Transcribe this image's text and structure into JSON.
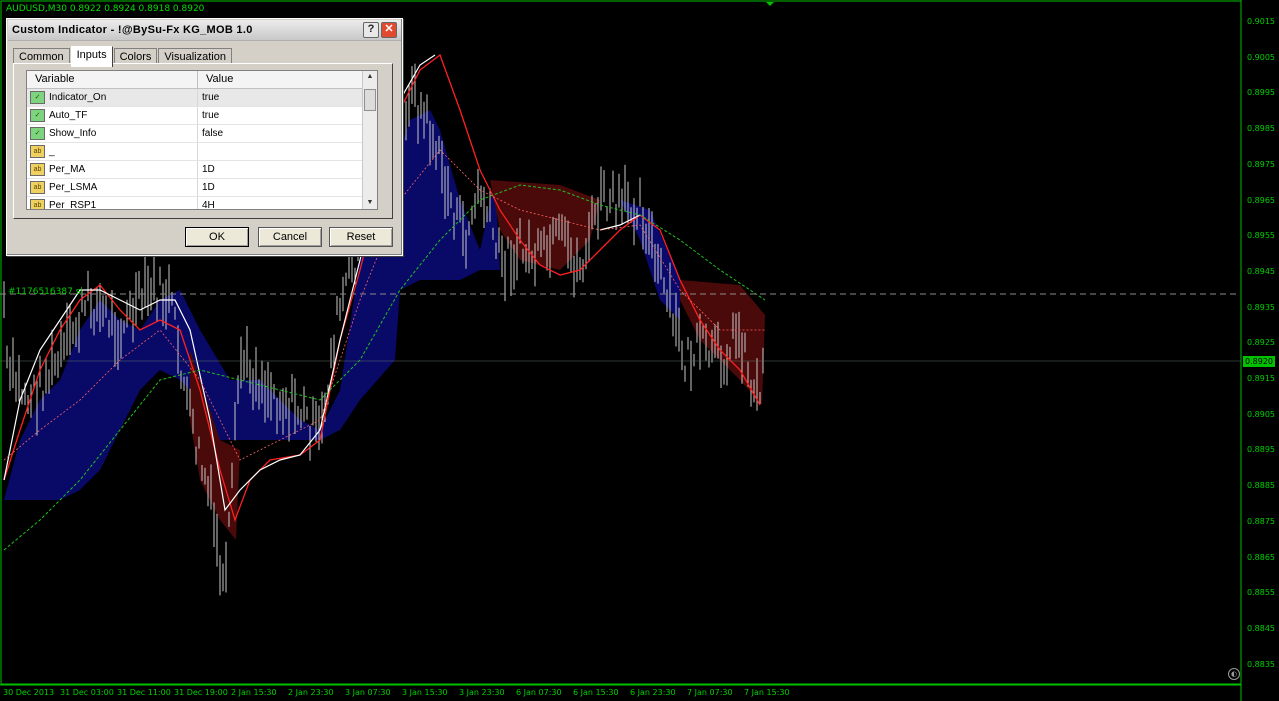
{
  "chart": {
    "symbol_info": "AUDUSD,M30  0.8922 0.8924 0.8918 0.8920",
    "order_label": "#1176516387 sl",
    "current_price": "0.8920",
    "price_ticks": [
      "0.9015",
      "0.9005",
      "0.8995",
      "0.8985",
      "0.8975",
      "0.8965",
      "0.8955",
      "0.8945",
      "0.8935",
      "0.8925",
      "0.8915",
      "0.8905",
      "0.8895",
      "0.8885",
      "0.8875",
      "0.8865",
      "0.8855",
      "0.8845",
      "0.8835"
    ],
    "time_ticks": [
      "30 Dec 2013",
      "31 Dec 03:00",
      "31 Dec 11:00",
      "31 Dec 19:00",
      "2 Jan 15:30",
      "2 Jan 23:30",
      "3 Jan 07:30",
      "3 Jan 15:30",
      "3 Jan 23:30",
      "6 Jan 07:30",
      "6 Jan 15:30",
      "6 Jan 23:30",
      "7 Jan 07:30",
      "7 Jan 15:30"
    ],
    "colors": {
      "background": "#000000",
      "axis": "#00c000",
      "candles": "#c8c8c8",
      "cloud_bull": "#0a0a6e",
      "cloud_bear": "#4a0a0a",
      "ma_red": "#ff2020",
      "ma_white": "#ffffff",
      "ma_green": "#20c020"
    },
    "icon": "chart-shift-icon"
  },
  "dialog": {
    "title": "Custom Indicator - !@BySu-Fx KG_MOB 1.0",
    "tabs": [
      "Common",
      "Inputs",
      "Colors",
      "Visualization"
    ],
    "active_tab": "Inputs",
    "columns": {
      "variable": "Variable",
      "value": "Value"
    },
    "rows": [
      {
        "name": "Indicator_On",
        "value": "true",
        "type": "bool"
      },
      {
        "name": "Auto_TF",
        "value": "true",
        "type": "bool"
      },
      {
        "name": "Show_Info",
        "value": "false",
        "type": "bool"
      },
      {
        "name": "_",
        "value": "",
        "type": "string"
      },
      {
        "name": "Per_MA",
        "value": "1D",
        "type": "string"
      },
      {
        "name": "Per_LSMA",
        "value": "1D",
        "type": "string"
      },
      {
        "name": "Per_RSP1",
        "value": "4H",
        "type": "string"
      }
    ],
    "buttons": {
      "ok": "OK",
      "cancel": "Cancel",
      "reset": "Reset"
    },
    "icons": {
      "help": "?",
      "close": "✕",
      "bool": "✓",
      "string": "ab"
    }
  }
}
